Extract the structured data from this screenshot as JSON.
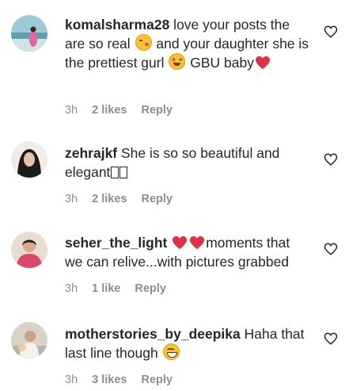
{
  "comments": [
    {
      "username": "komalsharma28",
      "text_parts": [
        " love your posts the are so real ",
        " and your daughter she is the prettiest gurl ",
        " GBU baby"
      ],
      "time": "3h",
      "likes": "2 likes",
      "reply": "Reply"
    },
    {
      "username": "zehrajkf",
      "text_parts": [
        " She is so so beautiful and elegant"
      ],
      "time": "3h",
      "likes": "2 likes",
      "reply": "Reply"
    },
    {
      "username": "seher_the_light",
      "text_parts": [
        " ",
        "moments that we can relive...with pictures grabbed"
      ],
      "time": "3h",
      "likes": "1 like",
      "reply": "Reply"
    },
    {
      "username": "motherstories_by_deepika",
      "text_parts": [
        " Haha that last line though "
      ],
      "time": "3h",
      "likes": "3 likes",
      "reply": "Reply"
    }
  ],
  "colors": {
    "text": "#262626",
    "meta": "#8e8e8e",
    "heart": "#e0304a",
    "background": "#ffffff"
  },
  "icons": [
    "heart-outline-icon",
    "red-heart-emoji",
    "kissing-face-emoji",
    "star-struck-emoji",
    "grinning-face-emoji"
  ]
}
